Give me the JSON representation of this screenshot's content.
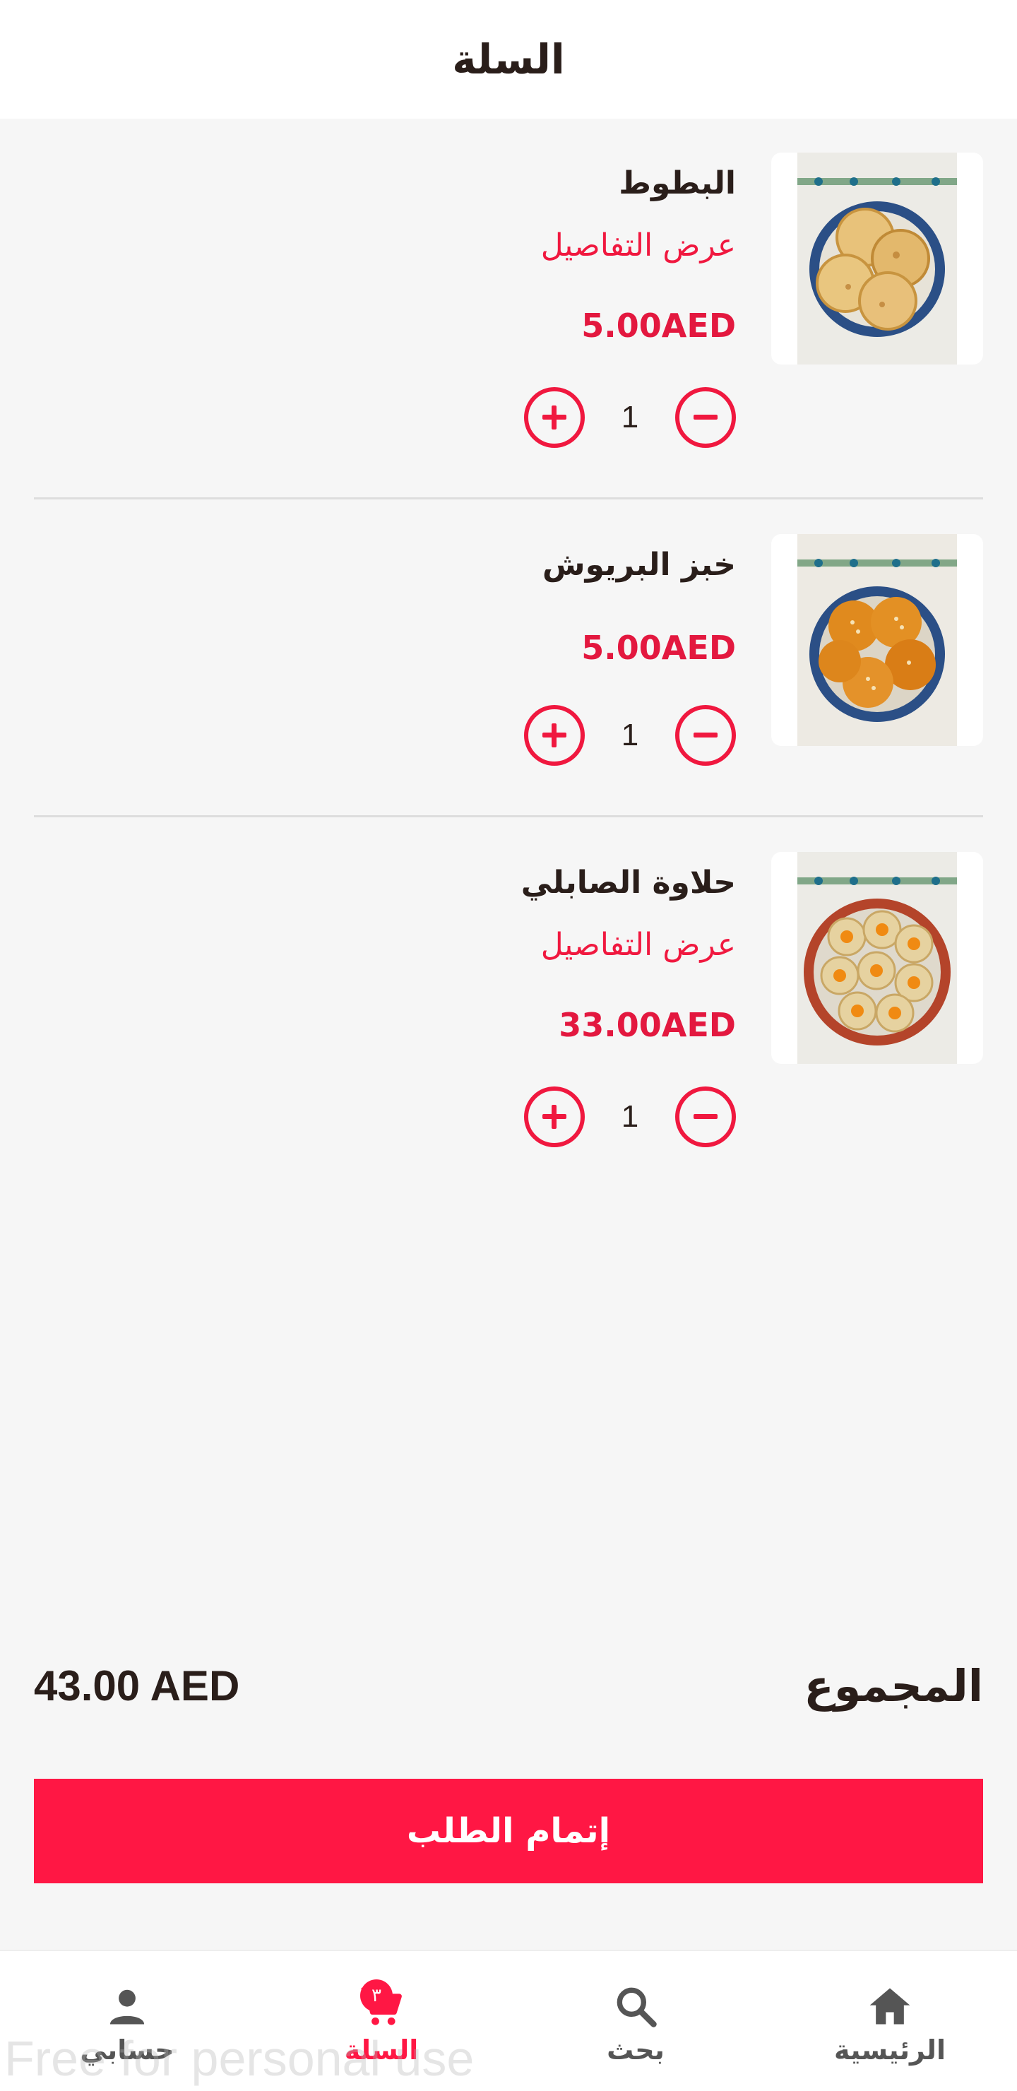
{
  "header": {
    "title": "السلة"
  },
  "cart": {
    "items": [
      {
        "name": "البطوط",
        "details_link": "عرض التفاصيل",
        "price": "5.00AED",
        "quantity": "1",
        "image": "batbout-plate-photo"
      },
      {
        "name": "خبز البريوش",
        "price": "5.00AED",
        "quantity": "1",
        "image": "brioche-plate-photo"
      },
      {
        "name": "حلاوة الصابلي",
        "details_link": "عرض التفاصيل",
        "price": "33.00AED",
        "quantity": "1",
        "image": "sable-cookies-plate-photo"
      }
    ]
  },
  "summary": {
    "total_label": "المجموع",
    "total_value": "43.00 AED"
  },
  "checkout": {
    "label": "إتمام الطلب"
  },
  "nav": {
    "items": [
      {
        "label": "الرئيسية",
        "icon": "home-icon"
      },
      {
        "label": "بحث",
        "icon": "search-icon"
      },
      {
        "label": "السلة",
        "icon": "cart-icon",
        "badge": "٣",
        "active": true
      },
      {
        "label": "حسابي",
        "icon": "person-icon"
      }
    ]
  },
  "watermark": "Free for personal use",
  "colors": {
    "accent": "#ff1744",
    "text": "#2a1e1a",
    "background": "#f6f6f6"
  }
}
